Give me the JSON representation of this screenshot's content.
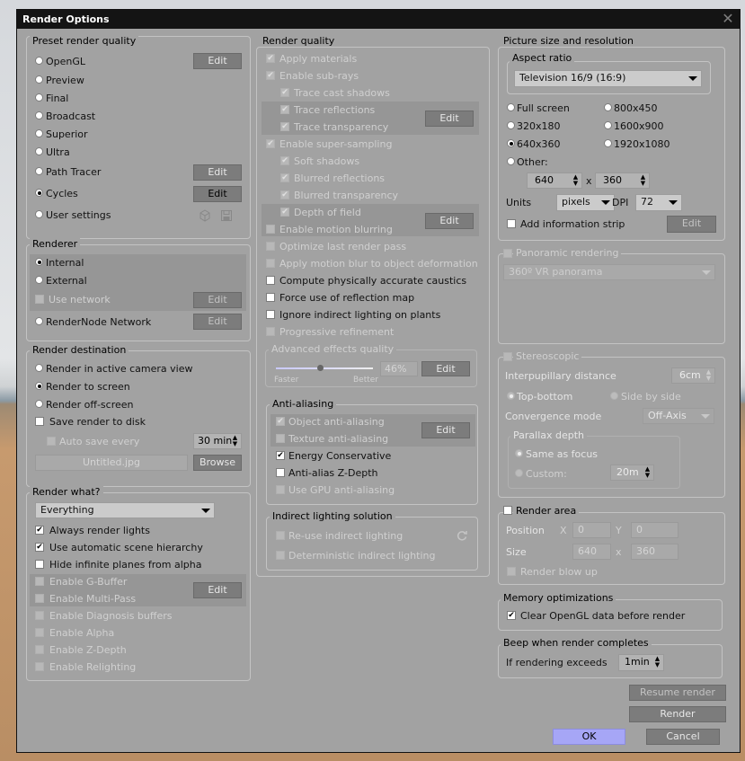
{
  "dialog": {
    "title": "Render Options",
    "close_icon": "close-icon"
  },
  "preset": {
    "title": "Preset render quality",
    "options": [
      "OpenGL",
      "Preview",
      "Final",
      "Broadcast",
      "Superior",
      "Ultra",
      "Path Tracer",
      "Cycles",
      "User settings"
    ],
    "selected": "Cycles",
    "edit": "Edit"
  },
  "renderer": {
    "title": "Renderer",
    "internal": "Internal",
    "external": "External",
    "use_network": "Use network",
    "rendernode": "RenderNode Network",
    "selected": "Internal",
    "edit": "Edit"
  },
  "destination": {
    "title": "Render destination",
    "camera": "Render in active camera view",
    "screen": "Render to screen",
    "offscreen": "Render off-screen",
    "selected": "Render to screen",
    "save_disk": "Save render to disk",
    "auto_save": "Auto save every",
    "auto_save_value": "30 min",
    "filename": "Untitled.jpg",
    "browse": "Browse"
  },
  "what": {
    "title": "Render what?",
    "value": "Everything",
    "always_lights": "Always render lights",
    "auto_hierarchy": "Use automatic scene hierarchy",
    "hide_planes": "Hide infinite planes from alpha",
    "gbuffer": "Enable G-Buffer",
    "multipass": "Enable Multi-Pass",
    "diagnosis": "Enable Diagnosis buffers",
    "alpha": "Enable Alpha",
    "zdepth": "Enable Z-Depth",
    "relighting": "Enable Relighting",
    "edit": "Edit"
  },
  "quality": {
    "title": "Render quality",
    "apply_materials": "Apply materials",
    "subrays": "Enable sub-rays",
    "trace_shadows": "Trace cast shadows",
    "trace_reflections": "Trace reflections",
    "trace_transparency": "Trace transparency",
    "supersampling": "Enable super-sampling",
    "soft_shadows": "Soft shadows",
    "blurred_reflections": "Blurred reflections",
    "blurred_transparency": "Blurred transparency",
    "dof": "Depth of field",
    "motion_blur": "Enable motion blurring",
    "optimize_last": "Optimize last render pass",
    "apply_motion_blur": "Apply motion blur to object deformation",
    "caustics": "Compute physically accurate caustics",
    "reflection_map": "Force use of reflection map",
    "ignore_indirect": "Ignore indirect lighting on plants",
    "progressive": "Progressive refinement",
    "advanced": "Advanced effects quality",
    "faster": "Faster",
    "better": "Better",
    "advanced_value": "46%",
    "advanced_fraction": 0.46,
    "edit": "Edit"
  },
  "antialias": {
    "title": "Anti-aliasing",
    "object": "Object anti-aliasing",
    "texture": "Texture anti-aliasing",
    "energy": "Energy Conservative",
    "zdepth": "Anti-alias Z-Depth",
    "gpu": "Use GPU anti-aliasing",
    "edit": "Edit"
  },
  "indirect": {
    "title": "Indirect lighting solution",
    "reuse": "Re-use indirect lighting",
    "deterministic": "Deterministic indirect lighting",
    "refresh_icon": "refresh-icon"
  },
  "picture": {
    "title": "Picture size and resolution",
    "aspect_title": "Aspect ratio",
    "aspect_value": "Television 16/9 (16:9)",
    "sizes": [
      "Full screen",
      "800x450",
      "320x180",
      "1600x900",
      "640x360",
      "1920x1080"
    ],
    "selected": "640x360",
    "other": "Other:",
    "width": "640",
    "x": "x",
    "height": "360",
    "units_label": "Units",
    "units": "pixels",
    "dpi_label": "DPI",
    "dpi": "72",
    "add_strip": "Add information strip",
    "edit": "Edit"
  },
  "panoramic": {
    "title": "Panoramic rendering",
    "value": "360º VR panorama"
  },
  "stereo": {
    "title": "Stereoscopic",
    "ipd_label": "Interpupillary distance",
    "ipd": "6cm",
    "top_bottom": "Top-bottom",
    "side_by_side": "Side by side",
    "conv_label": "Convergence mode",
    "conv": "Off-Axis",
    "parallax_title": "Parallax depth",
    "same_focus": "Same as focus",
    "custom": "Custom:",
    "custom_value": "20m"
  },
  "area": {
    "title": "Render area",
    "position": "Position",
    "x_label": "X",
    "x": "0",
    "y_label": "Y",
    "y": "0",
    "size": "Size",
    "width": "640",
    "x_sep": "x",
    "height": "360",
    "blowup": "Render blow up"
  },
  "memory": {
    "title": "Memory optimizations",
    "clear_opengl": "Clear OpenGL data before render"
  },
  "beep": {
    "title": "Beep when render completes",
    "if_exceeds": "If rendering exceeds",
    "value": "1min"
  },
  "actions": {
    "resume": "Resume render",
    "render": "Render",
    "ok": "OK",
    "cancel": "Cancel"
  },
  "colors": {
    "dialog_bg": "#a2a2a2",
    "titlebar": "#141414",
    "button": "#7c7c7c",
    "ok": "#a6a6f6"
  }
}
